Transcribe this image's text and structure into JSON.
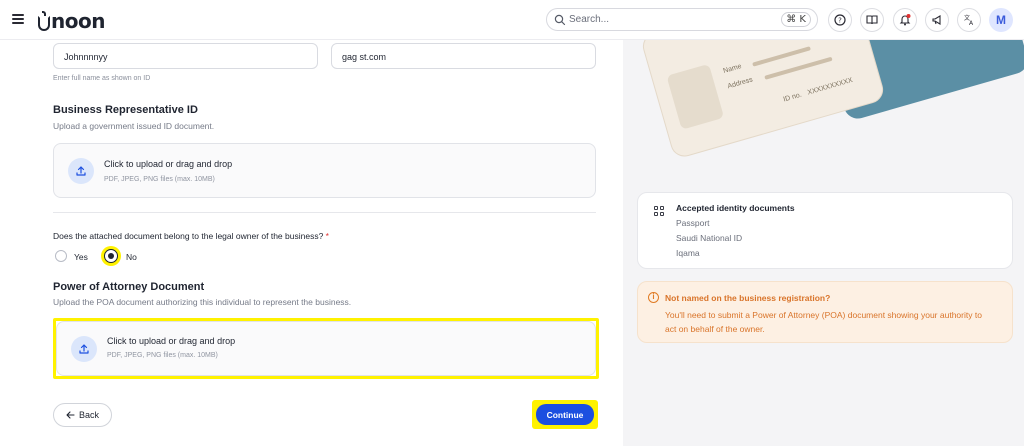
{
  "header": {
    "logo": "noon",
    "search_placeholder": "Search...",
    "search_shortcut": "⌘ K",
    "avatar_initial": "M"
  },
  "form": {
    "full_name_value": "Johnnnnyy",
    "email_value": "gag st.com",
    "full_name_hint": "Enter full name as shown on ID",
    "rep_id_title": "Business Representative ID",
    "rep_id_subtitle": "Upload a government issued ID document.",
    "rep_id_upload_main": "Click to upload or drag and drop",
    "rep_id_upload_sub": "PDF, JPEG, PNG files (max. 10MB)",
    "owner_question": "Does the attached document belong to the legal owner of the business?",
    "required_mark": "*",
    "radio_yes": "Yes",
    "radio_no": "No",
    "radio_selected": "No",
    "poa_title": "Power of Attorney Document",
    "poa_subtitle": "Upload the POA document authorizing this individual to represent the business.",
    "poa_upload_main": "Click to upload or drag and drop",
    "poa_upload_sub": "PDF, JPEG, PNG files (max. 10MB)",
    "back_label": "Back",
    "continue_label": "Continue"
  },
  "id_card": {
    "name_label": "Name",
    "address_label": "Address",
    "id_label": "ID no.",
    "id_value": "XXXXXXXXXX"
  },
  "accepted_docs": {
    "title": "Accepted identity documents",
    "items": [
      "Passport",
      "Saudi National ID",
      "Iqama"
    ]
  },
  "warning": {
    "title": "Not named on the business registration?",
    "body": "You'll need to submit a Power of Attorney (POA) document showing your authority to act on behalf of the owner."
  },
  "colors": {
    "primary": "#1c4fe0",
    "highlight": "#fff200",
    "warning_text": "#d9742a",
    "warning_bg": "#fdf0e3",
    "avatar_bg": "#dfe6ff"
  }
}
